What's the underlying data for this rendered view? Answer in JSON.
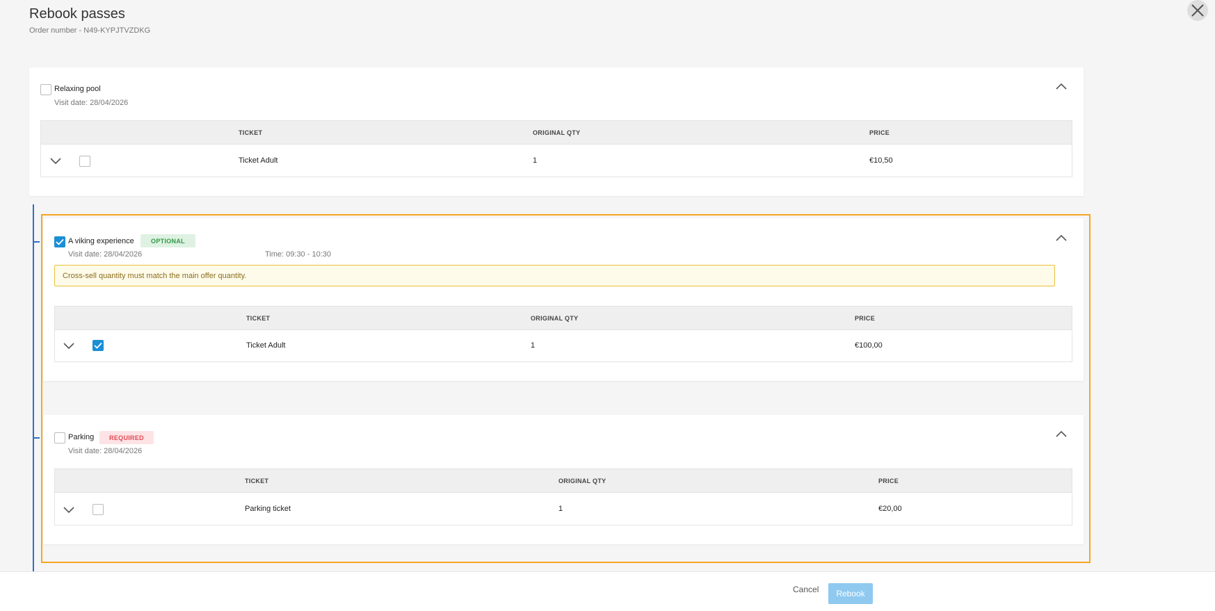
{
  "header": {
    "title": "Rebook passes",
    "order_number": "Order number - N49-KYPJTVZDKG"
  },
  "table_headers": {
    "ticket": "TICKET",
    "original_qty": "ORIGINAL QTY",
    "price": "PRICE"
  },
  "items": [
    {
      "title": "Relaxing pool",
      "checked": false,
      "visit_date": "Visit date: 28/04/2026",
      "rows": [
        {
          "ticket": "Ticket Adult",
          "qty": "1",
          "price": "€10,50",
          "checked": false
        }
      ]
    },
    {
      "title": "A viking experience",
      "checked": true,
      "badge": "OPTIONAL",
      "visit_date": "Visit date: 28/04/2026",
      "time": "Time: 09:30 - 10:30",
      "warning": "Cross-sell quantity must match the main offer quantity.",
      "rows": [
        {
          "ticket": "Ticket Adult",
          "qty": "1",
          "price": "€100,00",
          "checked": true
        }
      ]
    },
    {
      "title": "Parking",
      "checked": false,
      "badge": "REQUIRED",
      "visit_date": "Visit date: 28/04/2026",
      "rows": [
        {
          "ticket": "Parking ticket",
          "qty": "1",
          "price": "€20,00",
          "checked": false
        }
      ]
    }
  ],
  "footer": {
    "cancel_label": "Cancel",
    "rebook_label": "Rebook"
  },
  "colors": {
    "accent": "#1a8fd5",
    "highlight_frame": "#f5a623",
    "bundle_line": "#2d6fc7",
    "optional_badge": "#2e9a47",
    "required_badge": "#e24b55",
    "warning_border": "#e9c03a"
  }
}
